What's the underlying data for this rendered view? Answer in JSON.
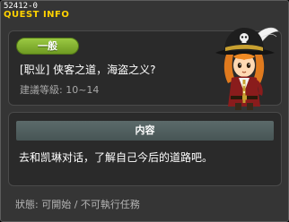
{
  "header": {
    "quest_id": "52412-0",
    "title": "QUEST INFO"
  },
  "quest": {
    "category": "一般",
    "name": "[职业] 侠客之道，海盗之义?",
    "level_label": "建議等級:",
    "level_range": "10~14",
    "npc_portrait": "pirate-npc"
  },
  "content": {
    "header": "内容",
    "text": "去和凯琳对话，了解自己今后的道路吧。"
  },
  "status": {
    "label": "狀態:",
    "value": "可開始 / 不可執行任務"
  },
  "colors": {
    "title": "#ffd200",
    "badge": "#7fae2c",
    "window_bg": "#353535",
    "panel_bg": "#2a2a2a"
  }
}
